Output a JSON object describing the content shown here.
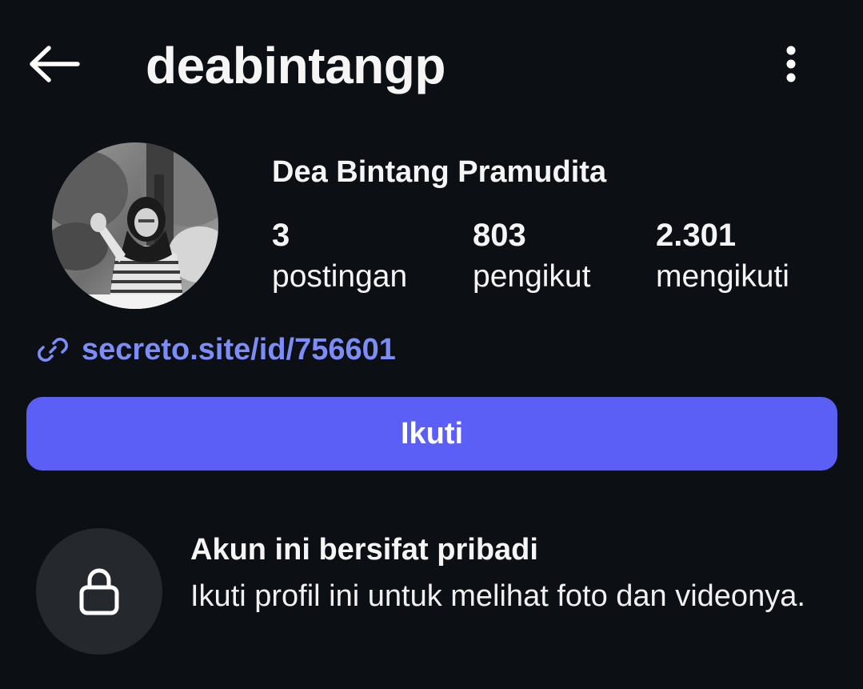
{
  "header": {
    "back_icon": "arrow-left-icon",
    "username": "deabintangp",
    "more_icon": "more-vertical-icon"
  },
  "profile": {
    "full_name": "Dea Bintang Pramudita",
    "stats": {
      "posts": {
        "count": "3",
        "label": "postingan"
      },
      "followers": {
        "count": "803",
        "label": "pengikut"
      },
      "following": {
        "count": "2.301",
        "label": "mengikuti"
      }
    },
    "link": {
      "icon": "link-icon",
      "text": "secreto.site/id/756601"
    }
  },
  "actions": {
    "follow_label": "Ikuti"
  },
  "private_notice": {
    "icon": "lock-icon",
    "title": "Akun ini bersifat pribadi",
    "description": "Ikuti profil ini untuk melihat foto dan videonya."
  },
  "colors": {
    "background": "#0c1014",
    "accent": "#5b5ff5",
    "link": "#7c8cf8",
    "lock_circle": "#25292e"
  }
}
